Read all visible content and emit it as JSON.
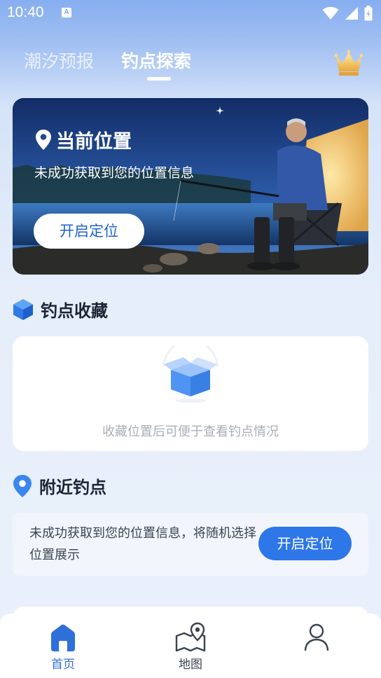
{
  "status_bar": {
    "time": "10:40",
    "notification_badge": "A",
    "icons": [
      "wifi-icon",
      "signal-icon",
      "battery-icon"
    ]
  },
  "tabs": [
    {
      "label": "潮汐预报",
      "active": false
    },
    {
      "label": "钓点探索",
      "active": true
    }
  ],
  "header": {
    "vip_icon": "crown-icon"
  },
  "hero": {
    "title": "当前位置",
    "subtitle": "未成功获取到您的位置信息",
    "button_label": "开启定位",
    "icon": "location-pin-icon"
  },
  "favorites": {
    "title": "钓点收藏",
    "icon": "cube-icon",
    "empty_text": "收藏位置后可便于查看钓点情况",
    "empty_icon": "open-box-icon"
  },
  "nearby": {
    "title": "附近钓点",
    "icon": "location-pin-icon",
    "message": "未成功获取到您的位置信息，将随机选择位置展示",
    "button_label": "开启定位"
  },
  "bottom_nav": {
    "items": [
      {
        "label": "首页",
        "icon": "home-icon",
        "active": true
      },
      {
        "label": "地图",
        "icon": "map-icon",
        "active": false
      },
      {
        "label": "",
        "icon": "user-icon",
        "active": false
      }
    ]
  },
  "colors": {
    "accent": "#2d77e8",
    "active_nav": "#2e6fd9",
    "hero_button_text": "#1f62c6"
  }
}
